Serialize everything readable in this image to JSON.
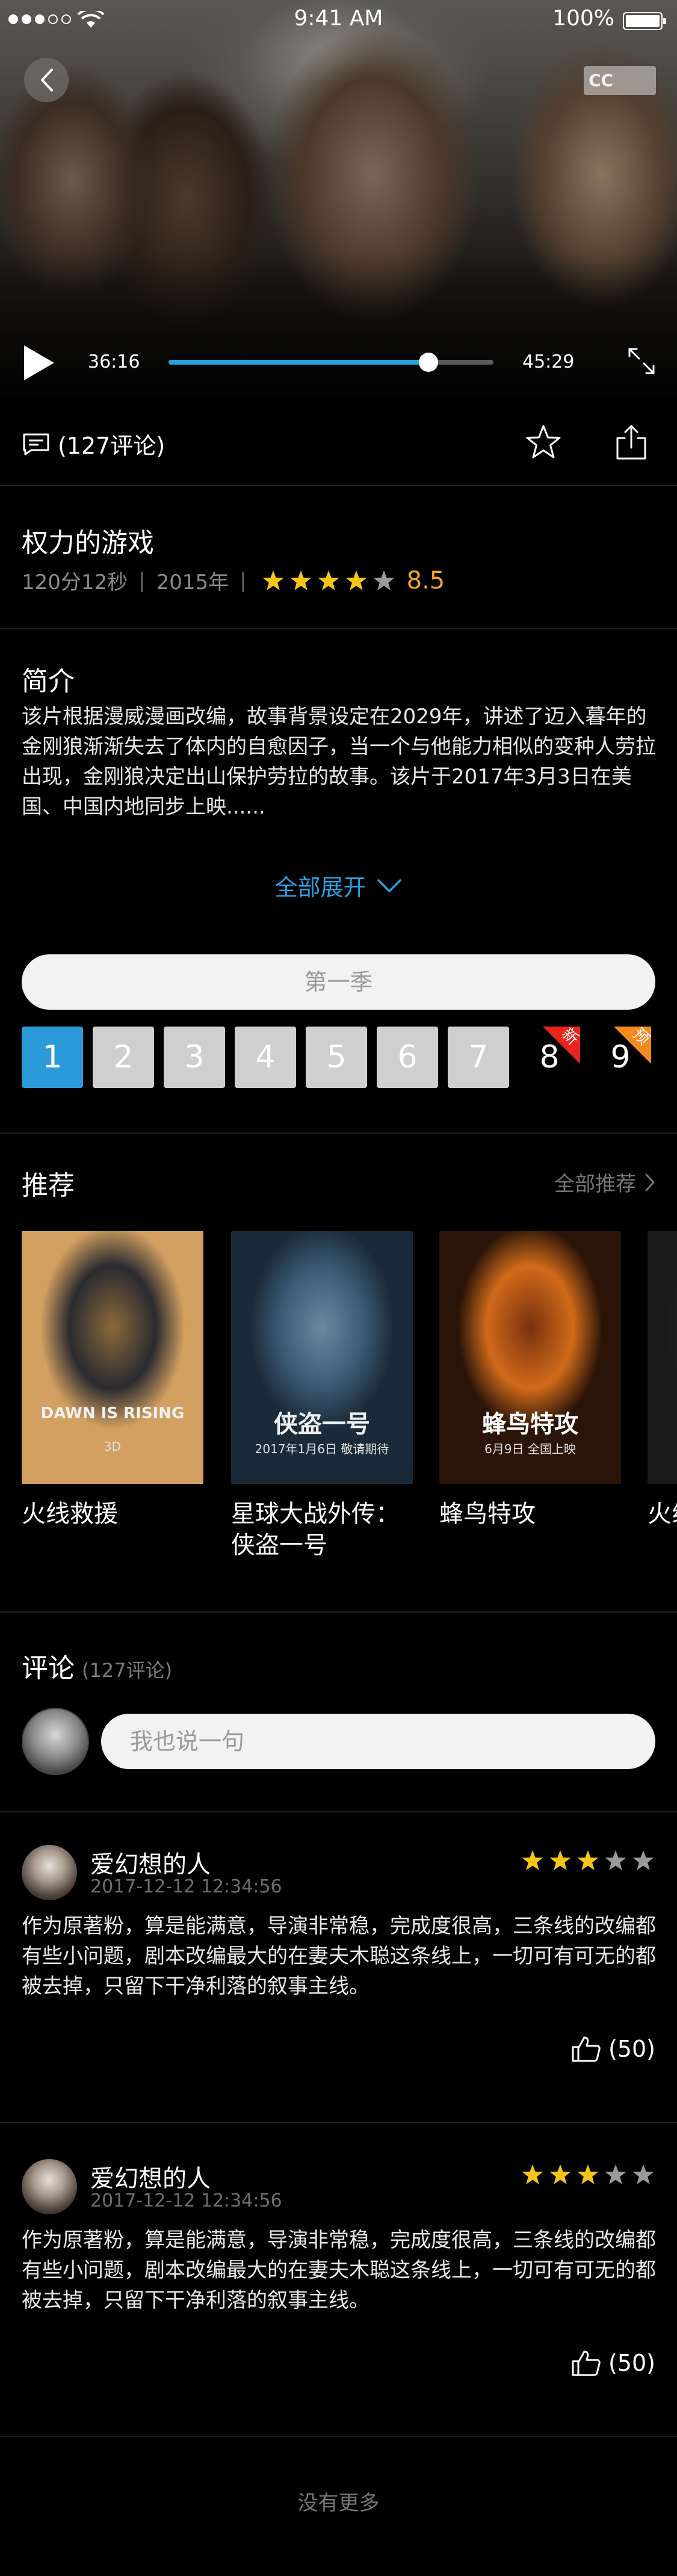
{
  "status_bar": {
    "time": "9:41 AM",
    "battery": "100%"
  },
  "player": {
    "current_time": "36:16",
    "total_time": "45:29",
    "progress": 0.8,
    "cc_label": "CC"
  },
  "actions": {
    "comments_label": "(127评论)"
  },
  "movie": {
    "title": "权力的游戏",
    "duration": "120分12秒",
    "year": "2015年",
    "stars": 4,
    "score": "8.5"
  },
  "synopsis": {
    "heading": "简介",
    "text": "该片根据漫威漫画改编，故事背景设定在2029年，讲述了迈入暮年的金刚狼渐渐失去了体内的自愈因子，当一个与他能力相似的变种人劳拉出现，金刚狼决定出山保护劳拉的故事。该片于2017年3月3日在美国、中国内地同步上映......",
    "expand_label": "全部展开"
  },
  "season": {
    "label": "第一季",
    "episodes": [
      {
        "num": "1",
        "state": "active"
      },
      {
        "num": "2",
        "state": "normal"
      },
      {
        "num": "3",
        "state": "normal"
      },
      {
        "num": "4",
        "state": "normal"
      },
      {
        "num": "5",
        "state": "normal"
      },
      {
        "num": "6",
        "state": "normal"
      },
      {
        "num": "7",
        "state": "normal"
      },
      {
        "num": "8",
        "state": "new",
        "badge": "新",
        "badge_color": "#e8241c"
      },
      {
        "num": "9",
        "state": "preview",
        "badge": "预",
        "badge_color": "#f58a1f"
      }
    ]
  },
  "recommend": {
    "heading": "推荐",
    "more_label": "全部推荐",
    "items": [
      {
        "name": "火线救援",
        "poster_text": "DAWN IS RISING",
        "poster_sub": "3D",
        "colors": [
          "#2a2a30",
          "#8a6a3a",
          "#d2a060"
        ]
      },
      {
        "name": "星球大战外传：侠盗一号",
        "poster_text": "侠盗一号",
        "poster_sub": "2017年1月6日 敬请期待",
        "colors": [
          "#3a5870",
          "#6a8aa0",
          "#1a2a38"
        ]
      },
      {
        "name": "蜂鸟特攻",
        "poster_text": "蜂鸟特攻",
        "poster_sub": "6月9日 全国上映",
        "colors": [
          "#d06a1a",
          "#7a3010",
          "#2a1408"
        ]
      },
      {
        "name": "火线",
        "poster_text": "",
        "poster_sub": "",
        "colors": [
          "#2a2a2a",
          "#6a5030",
          "#1a1a1a"
        ]
      }
    ]
  },
  "comments": {
    "heading": "评论",
    "count": "(127评论)",
    "input_placeholder": "我也说一句",
    "items": [
      {
        "user": "爱幻想的人",
        "date": "2017-12-12  12:34:56",
        "stars": 3,
        "text": "作为原著粉，算是能满意，导演非常稳，完成度很高，三条线的改编都有些小问题，剧本改编最大的在妻夫木聪这条线上，一切可有可无的都被去掉，只留下干净利落的叙事主线。",
        "likes": "(50)"
      },
      {
        "user": "爱幻想的人",
        "date": "2017-12-12  12:34:56",
        "stars": 3,
        "text": "作为原著粉，算是能满意，导演非常稳，完成度很高，三条线的改编都有些小问题，剧本改编最大的在妻夫木聪这条线上，一切可有可无的都被去掉，只留下干净利落的叙事主线。",
        "likes": "(50)"
      }
    ],
    "no_more": "没有更多"
  },
  "colors": {
    "accent": "#2aa0e0",
    "star": "#f5c518",
    "score": "#f5a623",
    "badge_new": "#e8241c",
    "badge_preview": "#f58a1f"
  }
}
